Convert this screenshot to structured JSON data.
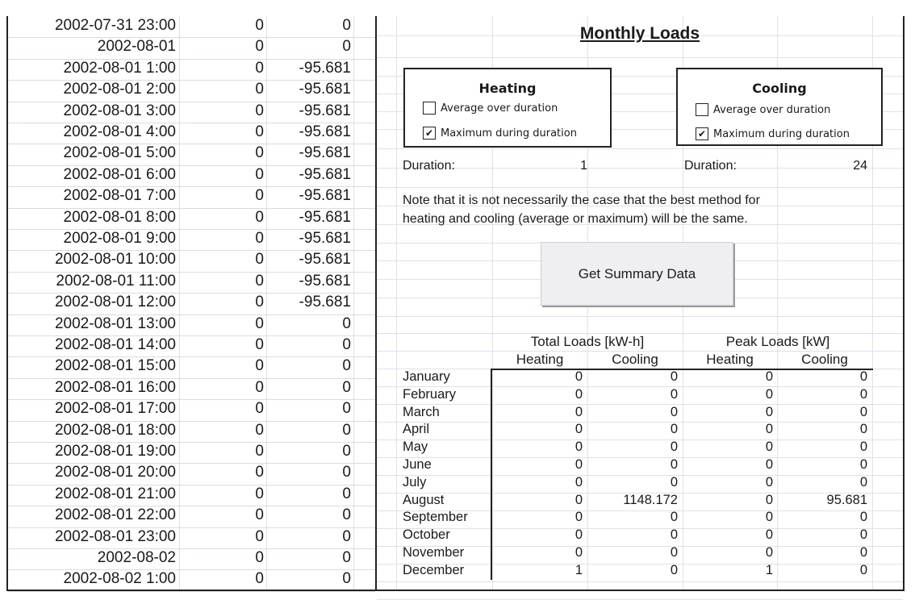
{
  "timeseries": {
    "rows": [
      {
        "datetime": "2002-07-31 23:00",
        "a": "0",
        "b": "0"
      },
      {
        "datetime": "2002-08-01",
        "a": "0",
        "b": "0"
      },
      {
        "datetime": "2002-08-01 1:00",
        "a": "0",
        "b": "-95.681"
      },
      {
        "datetime": "2002-08-01 2:00",
        "a": "0",
        "b": "-95.681"
      },
      {
        "datetime": "2002-08-01 3:00",
        "a": "0",
        "b": "-95.681"
      },
      {
        "datetime": "2002-08-01 4:00",
        "a": "0",
        "b": "-95.681"
      },
      {
        "datetime": "2002-08-01 5:00",
        "a": "0",
        "b": "-95.681"
      },
      {
        "datetime": "2002-08-01 6:00",
        "a": "0",
        "b": "-95.681"
      },
      {
        "datetime": "2002-08-01 7:00",
        "a": "0",
        "b": "-95.681"
      },
      {
        "datetime": "2002-08-01 8:00",
        "a": "0",
        "b": "-95.681"
      },
      {
        "datetime": "2002-08-01 9:00",
        "a": "0",
        "b": "-95.681"
      },
      {
        "datetime": "2002-08-01 10:00",
        "a": "0",
        "b": "-95.681"
      },
      {
        "datetime": "2002-08-01 11:00",
        "a": "0",
        "b": "-95.681"
      },
      {
        "datetime": "2002-08-01 12:00",
        "a": "0",
        "b": "-95.681"
      },
      {
        "datetime": "2002-08-01 13:00",
        "a": "0",
        "b": "0"
      },
      {
        "datetime": "2002-08-01 14:00",
        "a": "0",
        "b": "0"
      },
      {
        "datetime": "2002-08-01 15:00",
        "a": "0",
        "b": "0"
      },
      {
        "datetime": "2002-08-01 16:00",
        "a": "0",
        "b": "0"
      },
      {
        "datetime": "2002-08-01 17:00",
        "a": "0",
        "b": "0"
      },
      {
        "datetime": "2002-08-01 18:00",
        "a": "0",
        "b": "0"
      },
      {
        "datetime": "2002-08-01 19:00",
        "a": "0",
        "b": "0"
      },
      {
        "datetime": "2002-08-01 20:00",
        "a": "0",
        "b": "0"
      },
      {
        "datetime": "2002-08-01 21:00",
        "a": "0",
        "b": "0"
      },
      {
        "datetime": "2002-08-01 22:00",
        "a": "0",
        "b": "0"
      },
      {
        "datetime": "2002-08-01 23:00",
        "a": "0",
        "b": "0"
      },
      {
        "datetime": "2002-08-02",
        "a": "0",
        "b": "0"
      },
      {
        "datetime": "2002-08-02 1:00",
        "a": "0",
        "b": "0"
      }
    ]
  },
  "summary": {
    "title": "Monthly Loads",
    "heating": {
      "title": "Heating",
      "options": [
        {
          "label": "Average over duration",
          "checked": false
        },
        {
          "label": "Maximum during duration",
          "checked": true
        }
      ],
      "duration_label": "Duration:",
      "duration_value": "1"
    },
    "cooling": {
      "title": "Cooling",
      "options": [
        {
          "label": "Average over duration",
          "checked": false
        },
        {
          "label": "Maximum during duration",
          "checked": true
        }
      ],
      "duration_label": "Duration:",
      "duration_value": "24"
    },
    "note_line1": "Note that it is not necessarily the case that the best method for",
    "note_line2": "heating and cooling (average or maximum) will be the same.",
    "button_label": "Get Summary Data",
    "table": {
      "group_headers": [
        "Total Loads [kW-h]",
        "Peak Loads [kW]"
      ],
      "sub_headers": [
        "Heating",
        "Cooling",
        "Heating",
        "Cooling"
      ],
      "rows": [
        {
          "month": "January",
          "values": [
            "0",
            "0",
            "0",
            "0"
          ]
        },
        {
          "month": "February",
          "values": [
            "0",
            "0",
            "0",
            "0"
          ]
        },
        {
          "month": "March",
          "values": [
            "0",
            "0",
            "0",
            "0"
          ]
        },
        {
          "month": "April",
          "values": [
            "0",
            "0",
            "0",
            "0"
          ]
        },
        {
          "month": "May",
          "values": [
            "0",
            "0",
            "0",
            "0"
          ]
        },
        {
          "month": "June",
          "values": [
            "0",
            "0",
            "0",
            "0"
          ]
        },
        {
          "month": "July",
          "values": [
            "0",
            "0",
            "0",
            "0"
          ]
        },
        {
          "month": "August",
          "values": [
            "0",
            "1148.172",
            "0",
            "95.681"
          ]
        },
        {
          "month": "September",
          "values": [
            "0",
            "0",
            "0",
            "0"
          ]
        },
        {
          "month": "October",
          "values": [
            "0",
            "0",
            "0",
            "0"
          ]
        },
        {
          "month": "November",
          "values": [
            "0",
            "0",
            "0",
            "0"
          ]
        },
        {
          "month": "December",
          "values": [
            "1",
            "0",
            "1",
            "0"
          ]
        }
      ]
    }
  }
}
